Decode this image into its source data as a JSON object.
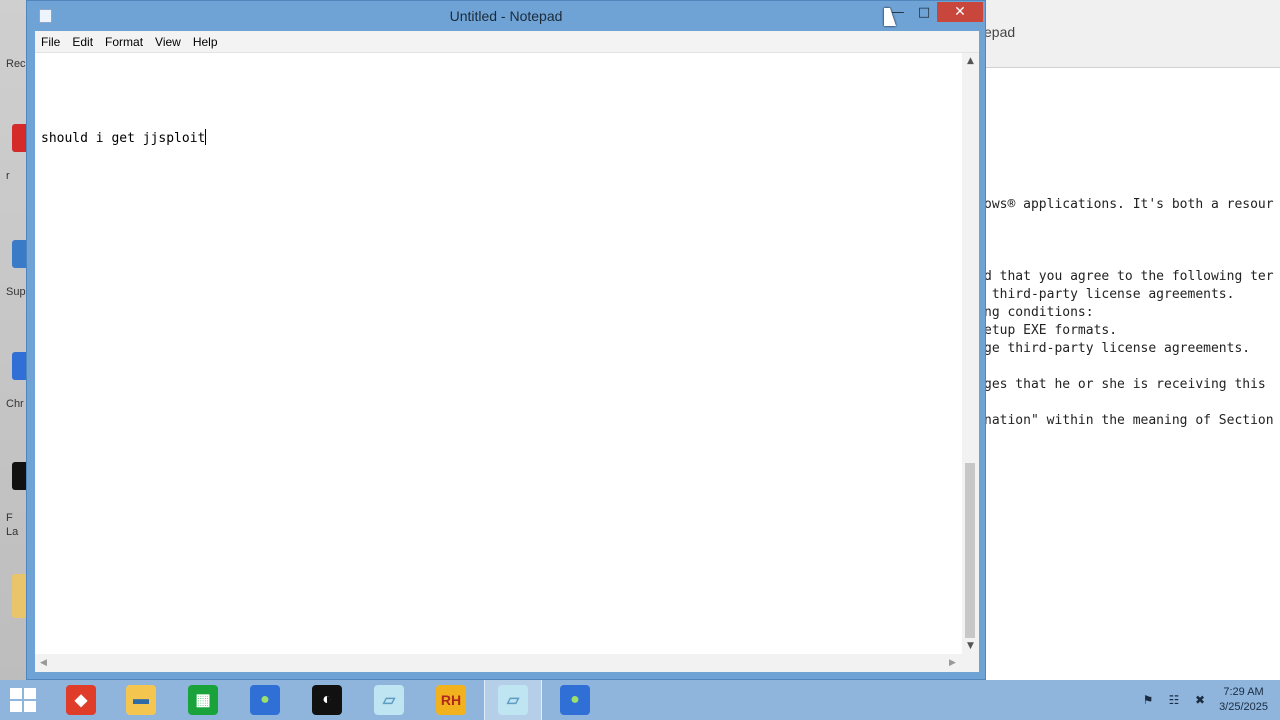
{
  "notepad": {
    "title": "Untitled - Notepad",
    "menu": [
      "File",
      "Edit",
      "Format",
      "View",
      "Help"
    ],
    "content": "should i get jjsploit",
    "controls": {
      "minimize": "—",
      "maximize": "□",
      "close": "✕"
    }
  },
  "background_window": {
    "title_fragment": "epad",
    "lines": [
      "ows® applications. It's both a resour",
      "",
      "",
      "",
      "d that you agree to the following ter",
      " third-party license agreements.",
      "ng conditions:",
      "etup EXE formats.",
      "ge third-party license agreements.",
      "",
      "ges that he or she is receiving this",
      "",
      "nation\" within the meaning of Section"
    ]
  },
  "desktop_icons": [
    {
      "label": "Rec",
      "color": "#888888"
    },
    {
      "label": "r",
      "color": "#d42a2a"
    },
    {
      "label": "Sup",
      "color": "#3a7bc8"
    },
    {
      "label": "Chr",
      "color": "#2f6fd6"
    },
    {
      "label": "F",
      "color": "#111111"
    },
    {
      "label": "La",
      "color": "#111111"
    },
    {
      "label": "",
      "color": "#e8c56a"
    }
  ],
  "taskbar": {
    "apps": [
      {
        "name": "gamemaker-icon",
        "glyph": "◆",
        "bg": "#e03c2a",
        "fg": "#ffffff"
      },
      {
        "name": "file-explorer-icon",
        "glyph": "▬",
        "bg": "#f4c64f",
        "fg": "#2d6aa6"
      },
      {
        "name": "store-icon",
        "glyph": "▦",
        "bg": "#1aa33a",
        "fg": "#ffffff"
      },
      {
        "name": "browser-icon",
        "glyph": "●",
        "bg": "#2f6fd6",
        "fg": "#9be06a"
      },
      {
        "name": "obs-icon",
        "glyph": "◐",
        "bg": "#111111",
        "fg": "#ffffff"
      },
      {
        "name": "notepad-app-icon",
        "glyph": "▱",
        "bg": "#bfe4f2",
        "fg": "#5f9dc4"
      },
      {
        "name": "rh-icon",
        "glyph": "RH",
        "bg": "#f2b21d",
        "fg": "#b0281e"
      },
      {
        "name": "notepad-active-icon",
        "glyph": "▱",
        "bg": "#bfe4f2",
        "fg": "#5f9dc4"
      },
      {
        "name": "chrome-icon",
        "glyph": "●",
        "bg": "#2f6fd6",
        "fg": "#9be06a"
      }
    ],
    "tray_icons": [
      "⚑",
      "☷",
      "✖"
    ],
    "time": "7:29 AM",
    "date": "3/25/2025"
  }
}
